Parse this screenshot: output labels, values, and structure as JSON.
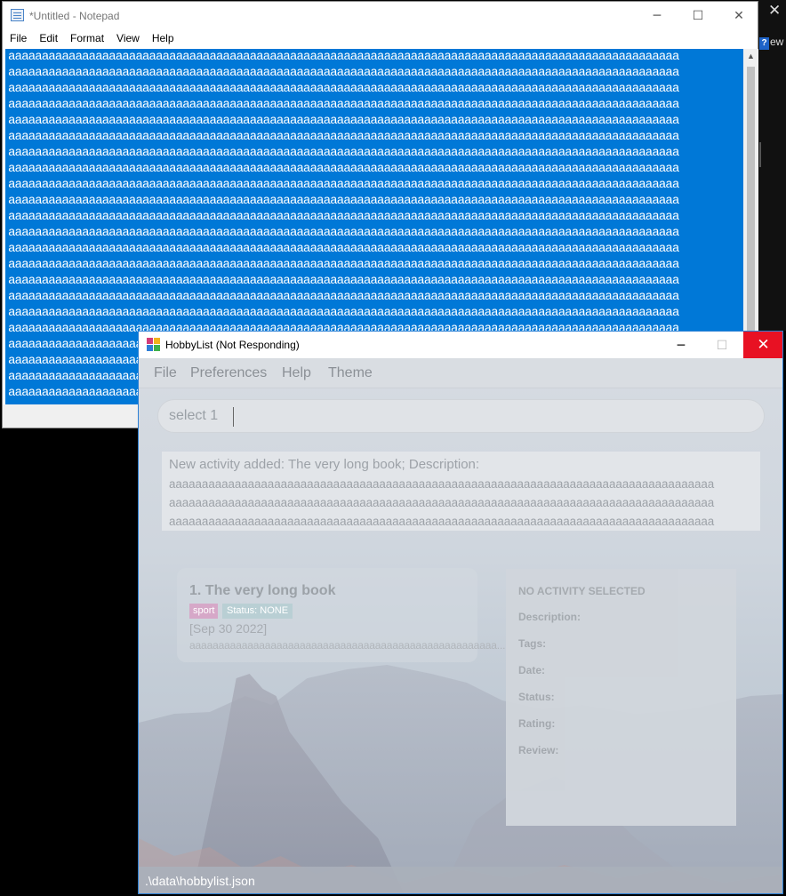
{
  "desktop": {
    "close_glyph": "✕",
    "help_glyph": "?",
    "partial_text": "ew"
  },
  "notepad": {
    "title": "*Untitled - Notepad",
    "menu": [
      "File",
      "Edit",
      "Format",
      "View",
      "Help"
    ],
    "line_text": "aaaaaaaaaaaaaaaaaaaaaaaaaaaaaaaaaaaaaaaaaaaaaaaaaaaaaaaaaaaaaaaaaaaaaaaaaaaaaaaaaaaaaaaaaaaaaaaaaaaa",
    "line_count": 22,
    "selection_color": "#0078d7"
  },
  "hobbylist": {
    "title": "HobbyList (Not Responding)",
    "menu": [
      "File",
      "Preferences",
      "Help",
      "Theme"
    ],
    "command_value": "select 1",
    "result": {
      "heading": "New activity added: The very long book; Description:",
      "lines": [
        "aaaaaaaaaaaaaaaaaaaaaaaaaaaaaaaaaaaaaaaaaaaaaaaaaaaaaaaaaaaaaaaaaaaaaaaaaaaaaaaaaaa",
        "aaaaaaaaaaaaaaaaaaaaaaaaaaaaaaaaaaaaaaaaaaaaaaaaaaaaaaaaaaaaaaaaaaaaaaaaaaaaaaaaaaa",
        "aaaaaaaaaaaaaaaaaaaaaaaaaaaaaaaaaaaaaaaaaaaaaaaaaaaaaaaaaaaaaaaaaaaaaaaaaaaaaaaaaaa"
      ]
    },
    "activity": {
      "name": "1.  The very long book",
      "tag": "sport",
      "status": "Status: NONE",
      "date": "[Sep 30 2022]",
      "description": "aaaaaaaaaaaaaaaaaaaaaaaaaaaaaaaaaaaaaaaaaaaaaaaaaaaaa..."
    },
    "detail": {
      "heading": "NO ACTIVITY SELECTED",
      "description": "Description:",
      "tags": "Tags:",
      "date": "Date:",
      "status": "Status:",
      "rating": "Rating:",
      "review": "Review:"
    },
    "status_path": ".\\data\\hobbylist.json",
    "colors": {
      "close": "#e81123",
      "tag": "#d6a8c8",
      "status_badge": "#b9cfd4"
    }
  }
}
